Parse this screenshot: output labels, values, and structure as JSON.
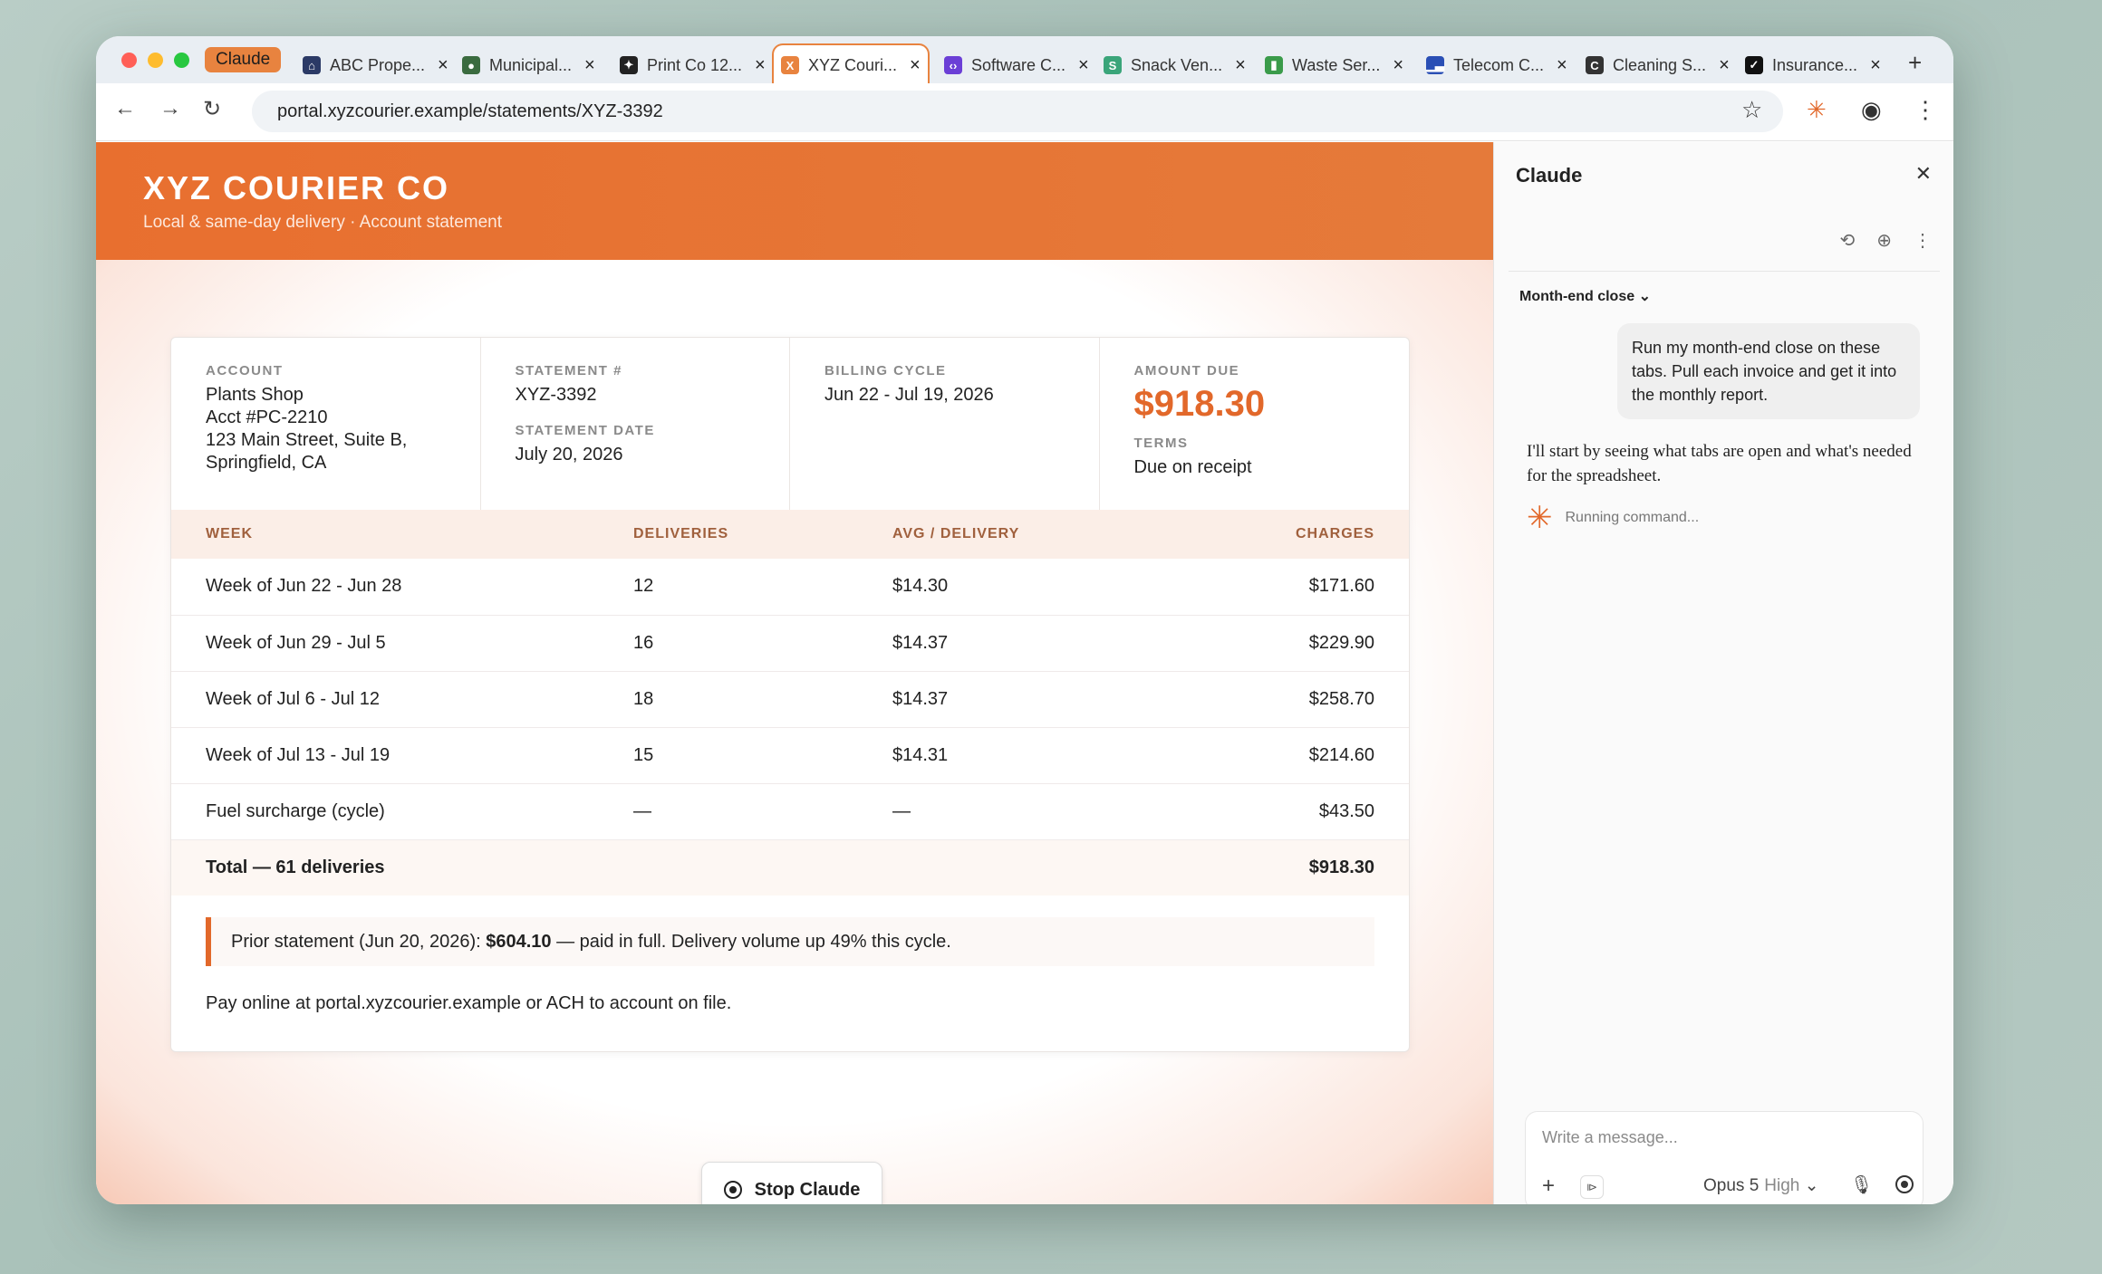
{
  "browser": {
    "tab_group_label": "Claude",
    "tabs": [
      {
        "label": "ABC Prope...",
        "icon": "home-icon",
        "color": "#2b3a66"
      },
      {
        "label": "Municipal...",
        "icon": "drop-icon",
        "color": "#3a6b3f"
      },
      {
        "label": "Print Co 12...",
        "icon": "printer-icon",
        "color": "#222222"
      },
      {
        "label": "XYZ Couri...",
        "icon": "courier-icon",
        "color": "#e8833f"
      },
      {
        "label": "Software C...",
        "icon": "code-icon",
        "color": "#6b3fd6"
      },
      {
        "label": "Snack Ven...",
        "icon": "snack-icon",
        "color": "#3aa57a"
      },
      {
        "label": "Waste Ser...",
        "icon": "trash-icon",
        "color": "#3a9b4a"
      },
      {
        "label": "Telecom C...",
        "icon": "chart-icon",
        "color": "#2a4fb5"
      },
      {
        "label": "Cleaning S...",
        "icon": "cleaning-icon",
        "color": "#333333"
      },
      {
        "label": "Insurance...",
        "icon": "shield-icon",
        "color": "#111111"
      }
    ],
    "url": "portal.xyzcourier.example/statements/XYZ-3392"
  },
  "banner": {
    "title": "XYZ COURIER CO",
    "subtitle": "Local & same-day delivery · Account statement"
  },
  "statement": {
    "account_label": "ACCOUNT",
    "account_lines": [
      "Plants Shop",
      "Acct #PC-2210",
      "123 Main Street, Suite B,",
      "Springfield, CA"
    ],
    "statement_no_label": "STATEMENT #",
    "statement_no": "XYZ-3392",
    "statement_date_label": "STATEMENT DATE",
    "statement_date": "July 20, 2026",
    "billing_cycle_label": "BILLING CYCLE",
    "billing_cycle": "Jun 22 - Jul 19, 2026",
    "amount_due_label": "AMOUNT DUE",
    "amount_due": "$918.30",
    "terms_label": "TERMS",
    "terms": "Due on receipt"
  },
  "table": {
    "headers": [
      "WEEK",
      "DELIVERIES",
      "AVG / DELIVERY",
      "CHARGES"
    ],
    "rows": [
      [
        "Week of Jun 22 - Jun 28",
        "12",
        "$14.30",
        "$171.60"
      ],
      [
        "Week of Jun 29 - Jul 5",
        "16",
        "$14.37",
        "$229.90"
      ],
      [
        "Week of Jul 6 - Jul 12",
        "18",
        "$14.37",
        "$258.70"
      ],
      [
        "Week of Jul 13 - Jul 19",
        "15",
        "$14.31",
        "$214.60"
      ],
      [
        "Fuel surcharge (cycle)",
        "—",
        "—",
        "$43.50"
      ]
    ],
    "total_label": "Total — 61 deliveries",
    "total_value": "$918.30"
  },
  "note": {
    "prefix": "Prior statement (Jun 20, 2026): ",
    "amount": "$604.10",
    "suffix": " — paid in full. Delivery volume up 49% this cycle."
  },
  "pay_line": "Pay online at portal.xyzcourier.example or ACH to account on file.",
  "stop_button": "Stop Claude",
  "panel": {
    "title": "Claude",
    "conversation": "Month-end close",
    "user_message": "Run my month-end close on these tabs. Pull each invoice and get it into the monthly report.",
    "assistant_message": "I'll start by seeing what tabs are open and what's needed for the spreadsheet.",
    "status": "Running command...",
    "input_placeholder": "Write a message...",
    "model": "Opus 5",
    "effort": "High"
  }
}
